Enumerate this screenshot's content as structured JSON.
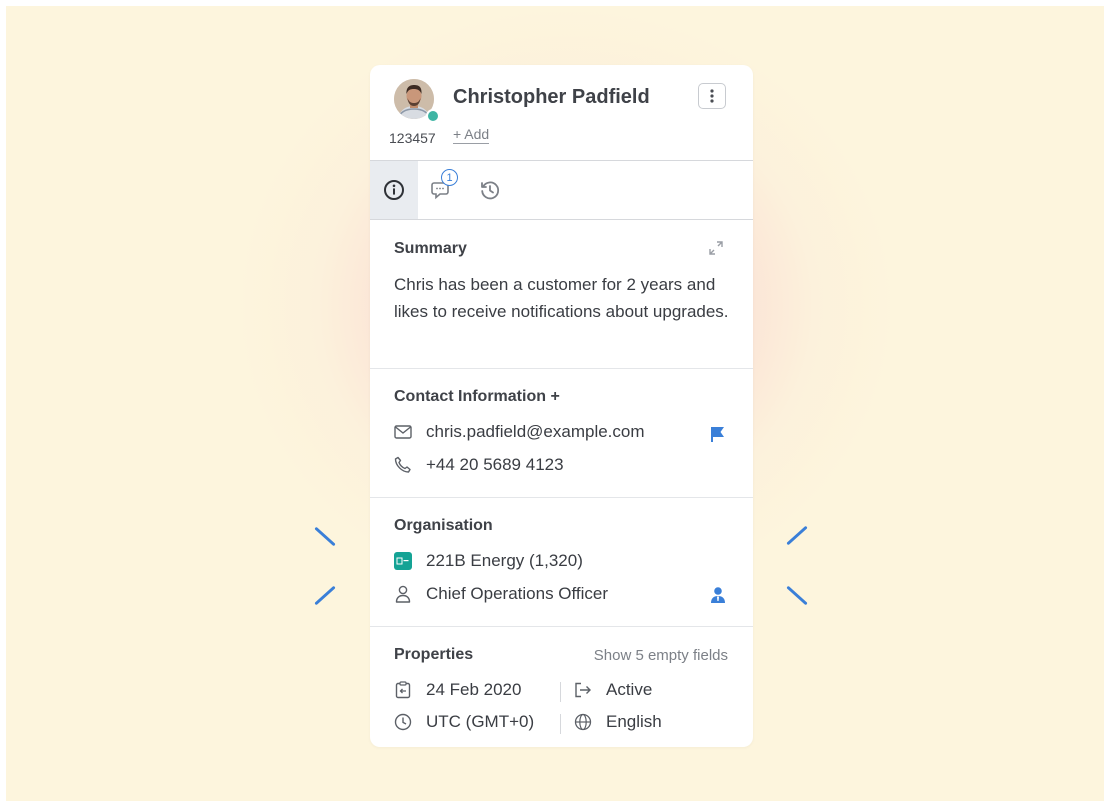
{
  "contact": {
    "name": "Christopher Padfield",
    "id": "123457",
    "add_label": "+ Add",
    "online": true
  },
  "tabs": [
    {
      "icon": "info-icon",
      "active": true
    },
    {
      "icon": "chat-icon",
      "badge": "1"
    },
    {
      "icon": "history-icon"
    }
  ],
  "summary": {
    "title": "Summary",
    "text": "Chris has been a customer for 2 years and likes to receive notifications about upgrades."
  },
  "contact_info": {
    "title": "Contact Information +",
    "email": "chris.padfield@example.com",
    "phone": "+44 20 5689 4123"
  },
  "organisation": {
    "title": "Organisation",
    "company": "221B Energy (1,320)",
    "role": "Chief Operations Officer"
  },
  "properties": {
    "title": "Properties",
    "show_empty": "Show 5 empty fields",
    "created": "24 Feb 2020",
    "status": "Active",
    "timezone": "UTC (GMT+0)",
    "language": "English"
  },
  "colors": {
    "accent": "#3a7fd8",
    "company_logo": "#14a395",
    "online_dot": "#3fb5a4",
    "background": "#fdf5dd",
    "glow": "#f6bac4"
  }
}
